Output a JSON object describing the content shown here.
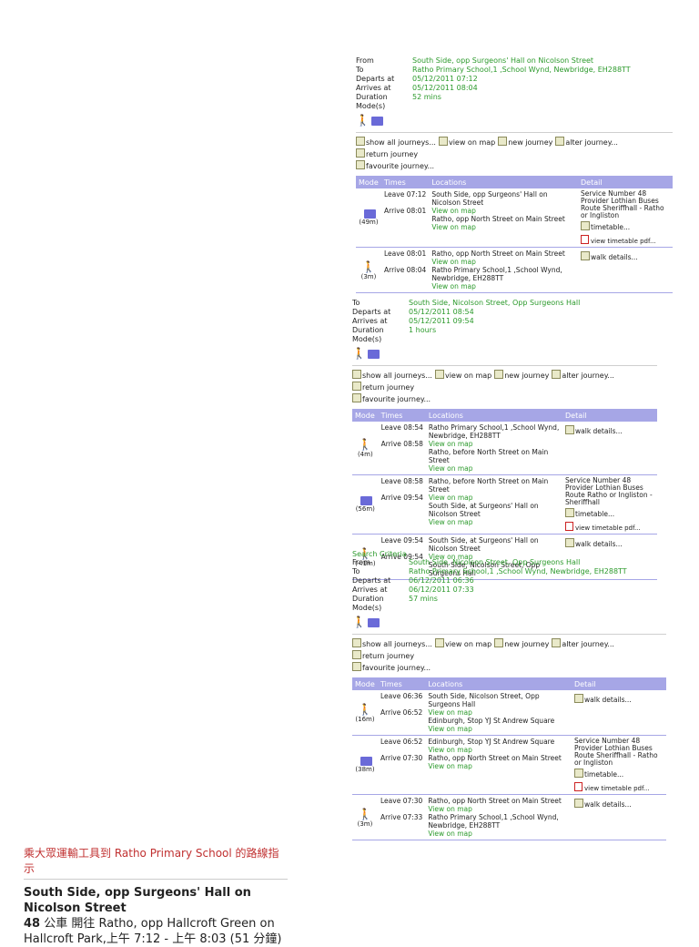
{
  "journeys": [
    {
      "summary": {
        "from_label": "From",
        "from": "South Side, opp Surgeons' Hall on Nicolson Street",
        "to_label": "To",
        "to": "Ratho Primary School,1 ,School Wynd, Newbridge, EH288TT",
        "departs_label": "Departs at",
        "departs": "05/12/2011 07:12",
        "arrives_label": "Arrives at",
        "arrives": "05/12/2011 08:04",
        "duration_label": "Duration",
        "duration": "52 mins",
        "modes_label": "Mode(s)"
      },
      "legs": [
        {
          "mode": "bus",
          "dur": "(49m)",
          "leave_time": "Leave 07:12",
          "leave_loc": "South Side, opp Surgeons' Hall on Nicolson Street",
          "leave_map": "View on map",
          "arrive_time": "Arrive 08:01",
          "arrive_loc": "Ratho, opp North Street on Main Street",
          "arrive_map": "View on map",
          "detail_lines": [
            "Service Number 48",
            "Provider Lothian Buses",
            "Route Sheriffhall - Ratho or Ingliston"
          ],
          "link1": "timetable...",
          "link2": "view timetable pdf..."
        },
        {
          "mode": "walk",
          "dur": "(3m)",
          "leave_time": "Leave 08:01",
          "leave_loc": "Ratho, opp North Street on Main Street",
          "leave_map": "View on map",
          "arrive_time": "Arrive 08:04",
          "arrive_loc": "Ratho Primary School,1 ,School Wynd, Newbridge, EH288TT",
          "arrive_map": "View on map",
          "detail_lines": [],
          "link1": "walk details...",
          "link2": ""
        }
      ]
    },
    {
      "summary": {
        "to_label": "To",
        "to": "South Side, Nicolson Street, Opp Surgeons Hall",
        "departs_label": "Departs at",
        "departs": "05/12/2011 08:54",
        "arrives_label": "Arrives at",
        "arrives": "05/12/2011 09:54",
        "duration_label": "Duration",
        "duration": "1 hours",
        "modes_label": "Mode(s)"
      },
      "legs": [
        {
          "mode": "walk",
          "dur": "(4m)",
          "leave_time": "Leave 08:54",
          "leave_loc": "Ratho Primary School,1 ,School Wynd, Newbridge, EH288TT",
          "leave_map": "View on map",
          "arrive_time": "Arrive 08:58",
          "arrive_loc": "Ratho, before North Street on Main Street",
          "arrive_map": "View on map",
          "detail_lines": [],
          "link1": "walk details...",
          "link2": ""
        },
        {
          "mode": "bus",
          "dur": "(56m)",
          "leave_time": "Leave 08:58",
          "leave_loc": "Ratho, before North Street on Main Street",
          "leave_map": "View on map",
          "arrive_time": "Arrive 09:54",
          "arrive_loc": "South Side, at Surgeons' Hall on Nicolson Street",
          "arrive_map": "View on map",
          "detail_lines": [
            "Service Number 48",
            "Provider Lothian Buses",
            "Route Ratho or Ingliston - Sheriffhall"
          ],
          "link1": "timetable...",
          "link2": "view timetable pdf..."
        },
        {
          "mode": "walk",
          "dur": "(<1m)",
          "leave_time": "Leave 09:54",
          "leave_loc": "South Side, at Surgeons' Hall on Nicolson Street",
          "leave_map": "View on map",
          "arrive_time": "Arrive 09:54",
          "arrive_loc": "South Side, Nicolson Street, Opp Surgeons Hall",
          "arrive_map": "",
          "detail_lines": [],
          "link1": "walk details...",
          "link2": ""
        }
      ]
    },
    {
      "criteria_label": "Search Criteria",
      "summary": {
        "from_label": "From",
        "from": "South Side, Nicolson Street, Opp Surgeons Hall",
        "to_label": "To",
        "to": "Ratho Primary School,1 ,School Wynd, Newbridge, EH288TT",
        "departs_label": "Departs at",
        "departs": "06/12/2011 06:36",
        "arrives_label": "Arrives at",
        "arrives": "06/12/2011 07:33",
        "duration_label": "Duration",
        "duration": "57 mins",
        "modes_label": "Mode(s)"
      },
      "legs": [
        {
          "mode": "walk",
          "dur": "(16m)",
          "leave_time": "Leave 06:36",
          "leave_loc": "South Side, Nicolson Street, Opp Surgeons Hall",
          "leave_map": "View on map",
          "arrive_time": "Arrive 06:52",
          "arrive_loc": "Edinburgh, Stop YJ St Andrew Square",
          "arrive_map": "View on map",
          "detail_lines": [],
          "link1": "walk details...",
          "link2": ""
        },
        {
          "mode": "bus",
          "dur": "(38m)",
          "leave_time": "Leave 06:52",
          "leave_loc": "Edinburgh, Stop YJ St Andrew Square",
          "leave_map": "View on map",
          "arrive_time": "Arrive 07:30",
          "arrive_loc": "Ratho, opp North Street on Main Street",
          "arrive_map": "View on map",
          "detail_lines": [
            "Service Number 48",
            "Provider Lothian Buses",
            "Route Sheriffhall - Ratho or Ingliston"
          ],
          "link1": "timetable...",
          "link2": "view timetable pdf..."
        },
        {
          "mode": "walk",
          "dur": "(3m)",
          "leave_time": "Leave 07:30",
          "leave_loc": "Ratho, opp North Street on Main Street",
          "leave_map": "View on map",
          "arrive_time": "Arrive 07:33",
          "arrive_loc": "Ratho Primary School,1 ,School Wynd, Newbridge, EH288TT",
          "arrive_map": "View on map",
          "detail_lines": [],
          "link1": "walk details...",
          "link2": ""
        }
      ]
    }
  ],
  "toolbar": {
    "show_all": "show all journeys...",
    "view_map": "view on map",
    "new_journey": "new journey",
    "alter_journey": "alter journey...",
    "return_journey": "return journey",
    "favourite": "favourite journey..."
  },
  "table_headers": {
    "mode": "Mode",
    "times": "Times",
    "locations": "Locations",
    "detail": "Detail"
  },
  "bottom": {
    "header": "乘大眾運輸工具到 Ratho Primary School 的路線指示",
    "title": "South Side, opp Surgeons' Hall on Nicolson Street",
    "route_no": "48",
    "desc": " 公車 開往 Ratho, opp Hallcroft Green on Hallcroft Park,上午 7:12 - 上午 8:03 (51 分鐘)"
  }
}
